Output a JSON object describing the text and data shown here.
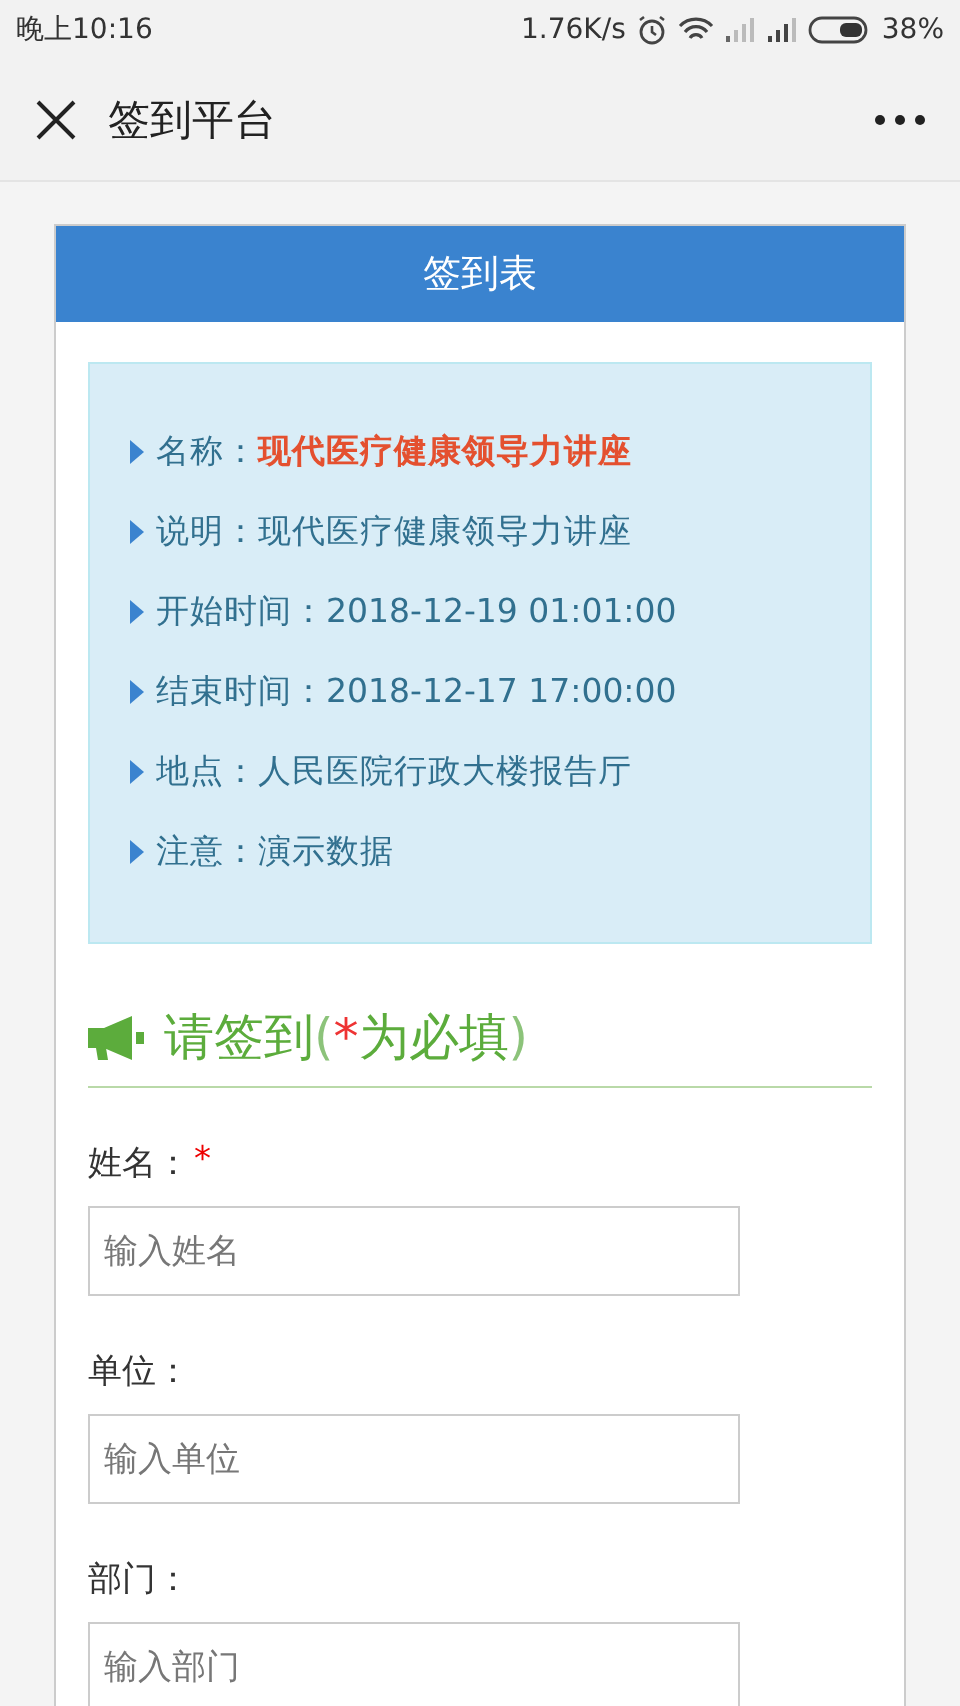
{
  "status_bar": {
    "time": "晚上10:16",
    "speed": "1.76K/s",
    "battery": "38%"
  },
  "nav": {
    "title": "签到平台"
  },
  "card": {
    "title": "签到表"
  },
  "info": [
    {
      "label": "名称：",
      "value": "现代医疗健康领导力讲座",
      "highlight": true
    },
    {
      "label": "说明：",
      "value": "现代医疗健康领导力讲座",
      "highlight": false
    },
    {
      "label": "开始时间：",
      "value": "2018-12-19 01:01:00",
      "highlight": false
    },
    {
      "label": "结束时间：",
      "value": "2018-12-17 17:00:00",
      "highlight": false
    },
    {
      "label": "地点：",
      "value": "人民医院行政大楼报告厅",
      "highlight": false
    },
    {
      "label": "注意：",
      "value": "演示数据",
      "highlight": false
    }
  ],
  "heading": {
    "title": "请签到",
    "open": "(",
    "star": "*",
    "note": "为必填",
    "close": ")"
  },
  "fields": [
    {
      "label": "姓名：",
      "required_mark": "*",
      "placeholder": "输入姓名"
    },
    {
      "label": "单位：",
      "placeholder": "输入单位"
    },
    {
      "label": "部门：",
      "placeholder": "输入部门"
    }
  ]
}
